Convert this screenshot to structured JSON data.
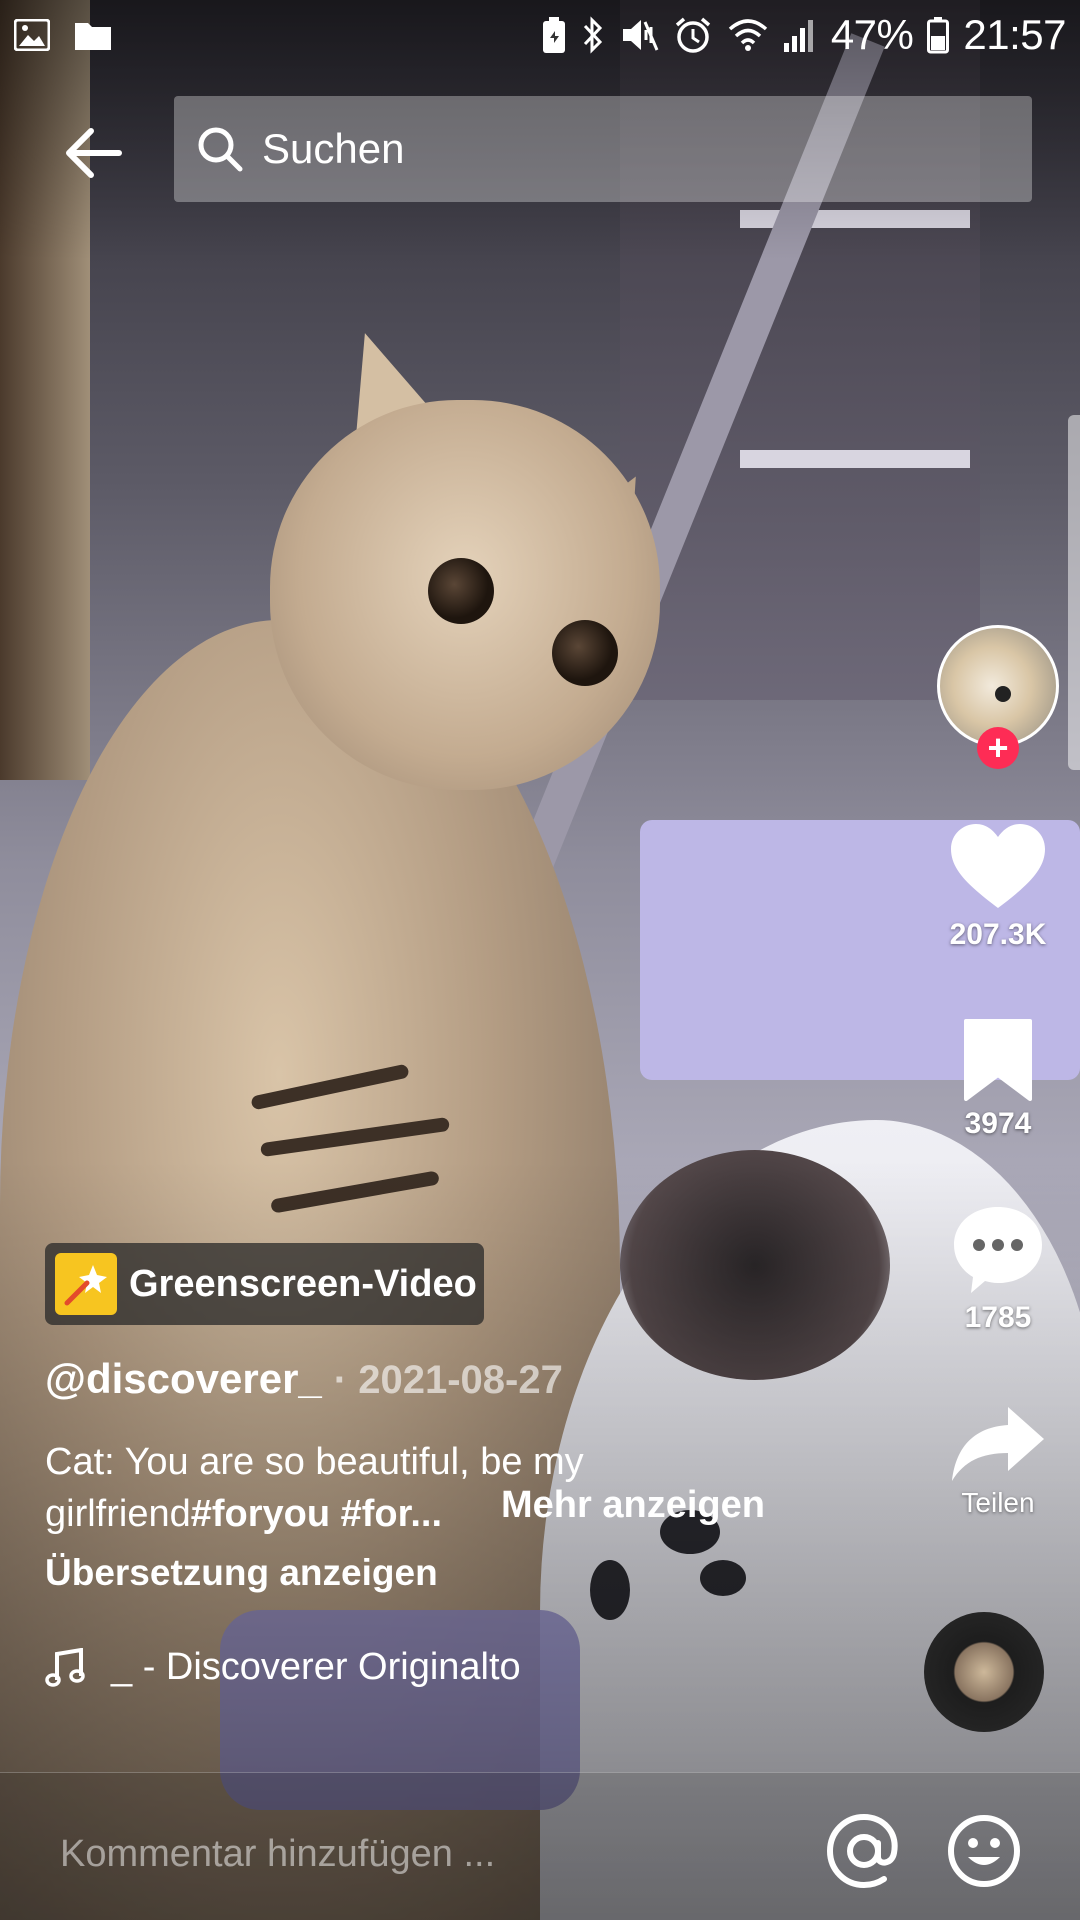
{
  "status_bar": {
    "battery": "47%",
    "time": "21:57"
  },
  "search": {
    "placeholder": "Suchen"
  },
  "actions": {
    "likes": "207.3K",
    "saves": "3974",
    "comments": "1785",
    "share_label": "Teilen"
  },
  "effect": {
    "label": "Greenscreen-Video"
  },
  "post": {
    "author": "@discoverer_",
    "date": "· 2021-08-27",
    "caption_line1": "Cat: You are so beautiful, be my",
    "caption_line2_plain": "girlfriend",
    "caption_line2_tags": "#foryou #for...",
    "more_label": "Mehr anzeigen",
    "translate_label": "Übersetzung anzeigen",
    "music": "_ - Discoverer    Originalto"
  },
  "comment": {
    "placeholder": "Kommentar hinzufügen ..."
  },
  "colors": {
    "follow_plus": "#fe2c55",
    "effect_icon": "#f7c520"
  },
  "icons": [
    "gallery-icon",
    "folder-icon",
    "battery-saver-icon",
    "bluetooth-icon",
    "mute-icon",
    "alarm-icon",
    "wifi-icon",
    "signal-icon",
    "battery-icon",
    "back-arrow-icon",
    "search-icon",
    "heart-icon",
    "bookmark-icon",
    "comment-icon",
    "share-icon",
    "music-note-icon",
    "at-icon",
    "emoji-icon"
  ]
}
